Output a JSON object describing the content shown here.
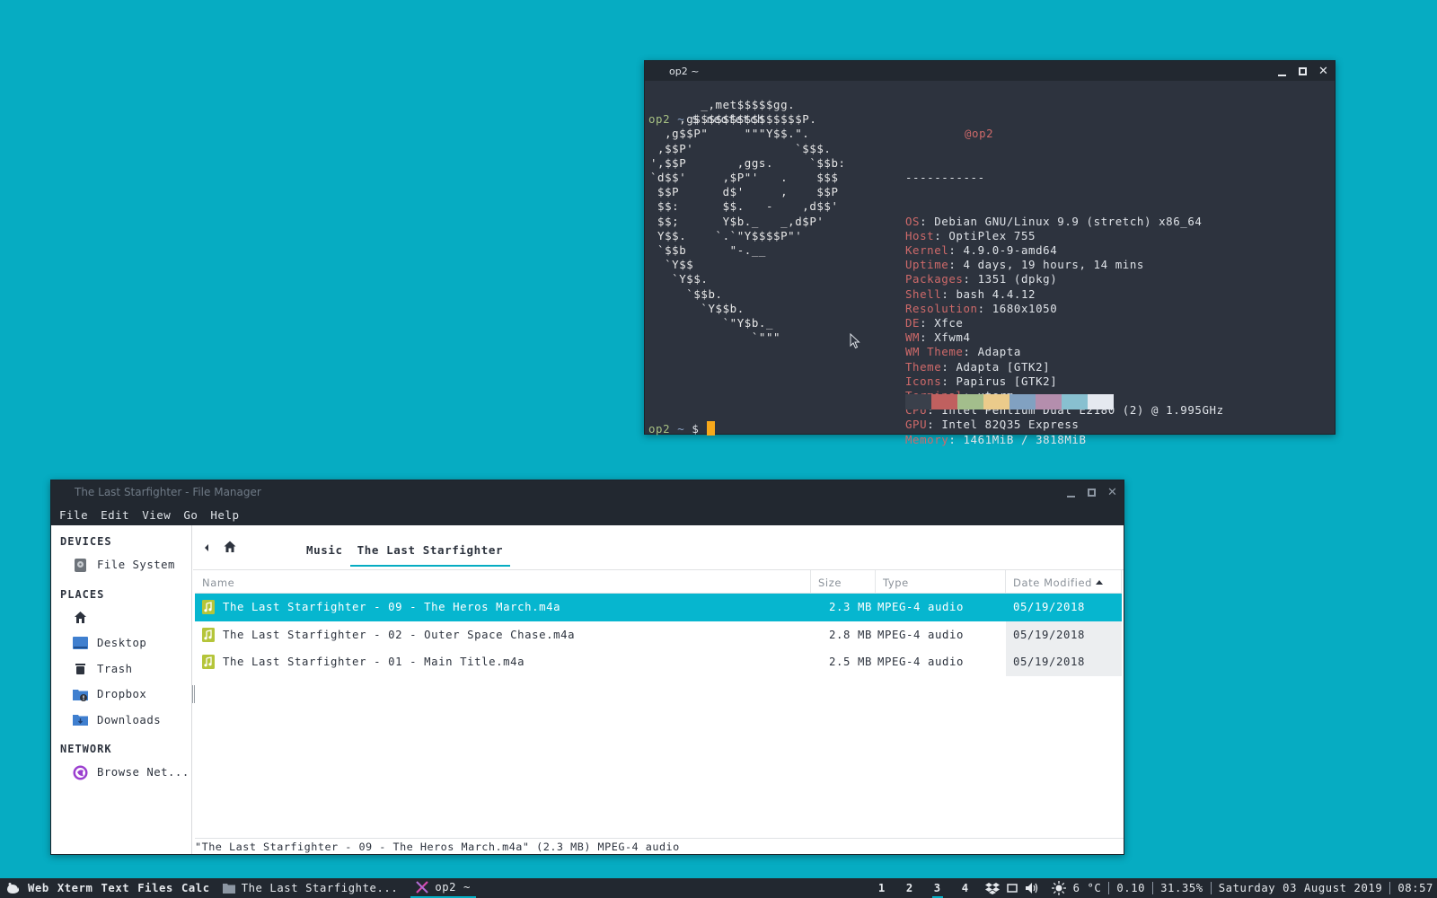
{
  "terminal": {
    "title": "op2 ~",
    "prompt_host": "op2",
    "prompt_tilde": "~",
    "prompt_symbol": "$",
    "command": "neofetch",
    "ascii": [
      "       _,met$$$$$gg.",
      "    ,g$$$$$$$$$$$$$$$P.",
      "  ,g$$P\"     \"\"\"Y$$.\".",
      " ,$$P'              `$$$.",
      "',$$P       ,ggs.     `$$b:",
      "`d$$'     ,$P\"'   .    $$$",
      " $$P      d$'     ,    $$P",
      " $$:      $$.   -    ,d$$'",
      " $$;      Y$b._   _,d$P'",
      " Y$$.    `.`\"Y$$$$P\"'",
      " `$$b      \"-.__",
      "  `Y$$",
      "   `Y$$.",
      "     `$$b.",
      "       `Y$$b.",
      "          `\"Y$b._",
      "              `\"\"\""
    ],
    "user_line": "@op2",
    "divider": "-----------",
    "info": [
      {
        "key": "OS",
        "value": "Debian GNU/Linux 9.9 (stretch) x86_64"
      },
      {
        "key": "Host",
        "value": "OptiPlex 755"
      },
      {
        "key": "Kernel",
        "value": "4.9.0-9-amd64"
      },
      {
        "key": "Uptime",
        "value": "4 days, 19 hours, 14 mins"
      },
      {
        "key": "Packages",
        "value": "1351 (dpkg)"
      },
      {
        "key": "Shell",
        "value": "bash 4.4.12"
      },
      {
        "key": "Resolution",
        "value": "1680x1050"
      },
      {
        "key": "DE",
        "value": "Xfce"
      },
      {
        "key": "WM",
        "value": "Xfwm4"
      },
      {
        "key": "WM Theme",
        "value": "Adapta"
      },
      {
        "key": "Theme",
        "value": "Adapta [GTK2]"
      },
      {
        "key": "Icons",
        "value": "Papirus [GTK2]"
      },
      {
        "key": "Terminal",
        "value": "xterm"
      },
      {
        "key": "CPU",
        "value": "Intel Pentium Dual E2180 (2) @ 1.995GHz"
      },
      {
        "key": "GPU",
        "value": "Intel 82Q35 Express"
      },
      {
        "key": "Memory",
        "value": "1461MiB / 3818MiB"
      }
    ],
    "swatches": [
      "#3a404b",
      "#c0605f",
      "#a3be8c",
      "#ebcb8b",
      "#81a1c1",
      "#b48ead",
      "#88c0d0",
      "#e5e9f0"
    ],
    "colors": {
      "background": "#2d333e",
      "key": "#cf6a6a",
      "prompt_host": "#a7c183",
      "cursor": "#f7a81b"
    }
  },
  "file_manager": {
    "title": "The Last Starfighter - File Manager",
    "menu": [
      "File",
      "Edit",
      "View",
      "Go",
      "Help"
    ],
    "sidebar": {
      "devices_header": "DEVICES",
      "devices": [
        {
          "label": "File System",
          "icon": "drive-icon"
        }
      ],
      "places_header": "PLACES",
      "places": [
        {
          "label": "",
          "icon": "home-icon"
        },
        {
          "label": "Desktop",
          "icon": "desktop-icon"
        },
        {
          "label": "Trash",
          "icon": "trash-icon"
        },
        {
          "label": "Dropbox",
          "icon": "dropbox-folder-icon"
        },
        {
          "label": "Downloads",
          "icon": "downloads-folder-icon"
        }
      ],
      "network_header": "NETWORK",
      "network": [
        {
          "label": "Browse Net...",
          "icon": "network-icon"
        }
      ]
    },
    "breadcrumbs": [
      "Music",
      "The Last Starfighter"
    ],
    "columns": {
      "name": "Name",
      "size": "Size",
      "type": "Type",
      "date": "Date Modified"
    },
    "files": [
      {
        "name": "The Last Starfighter - 09 - The Heros March.m4a",
        "size": "2.3 MB",
        "type": "MPEG-4 audio",
        "date": "05/19/2018",
        "selected": true
      },
      {
        "name": "The Last Starfighter - 02 - Outer Space Chase.m4a",
        "size": "2.8 MB",
        "type": "MPEG-4 audio",
        "date": "05/19/2018",
        "selected": false
      },
      {
        "name": "The Last Starfighter - 01 - Main Title.m4a",
        "size": "2.5 MB",
        "type": "MPEG-4 audio",
        "date": "05/19/2018",
        "selected": false
      }
    ],
    "status": "\"The Last Starfighter - 09 - The Heros March.m4a\" (2.3 MB) MPEG-4 audio",
    "colors": {
      "selection": "#06b6cf",
      "accent": "#06acc2"
    }
  },
  "panel": {
    "launchers": [
      "Web",
      "Xterm",
      "Text",
      "Files",
      "Calc"
    ],
    "tasks": [
      {
        "label": "The Last Starfighte...",
        "icon": "folder-icon",
        "active": false
      },
      {
        "label": "op2 ~",
        "icon": "xterm-icon",
        "active": true
      }
    ],
    "workspaces": [
      "1",
      "2",
      "3",
      "4"
    ],
    "current_workspace": "3",
    "weather": "6 °C",
    "load": "0.10",
    "cpu": "31.35%",
    "date": "Saturday 03 August 2019",
    "time": "08:57"
  }
}
